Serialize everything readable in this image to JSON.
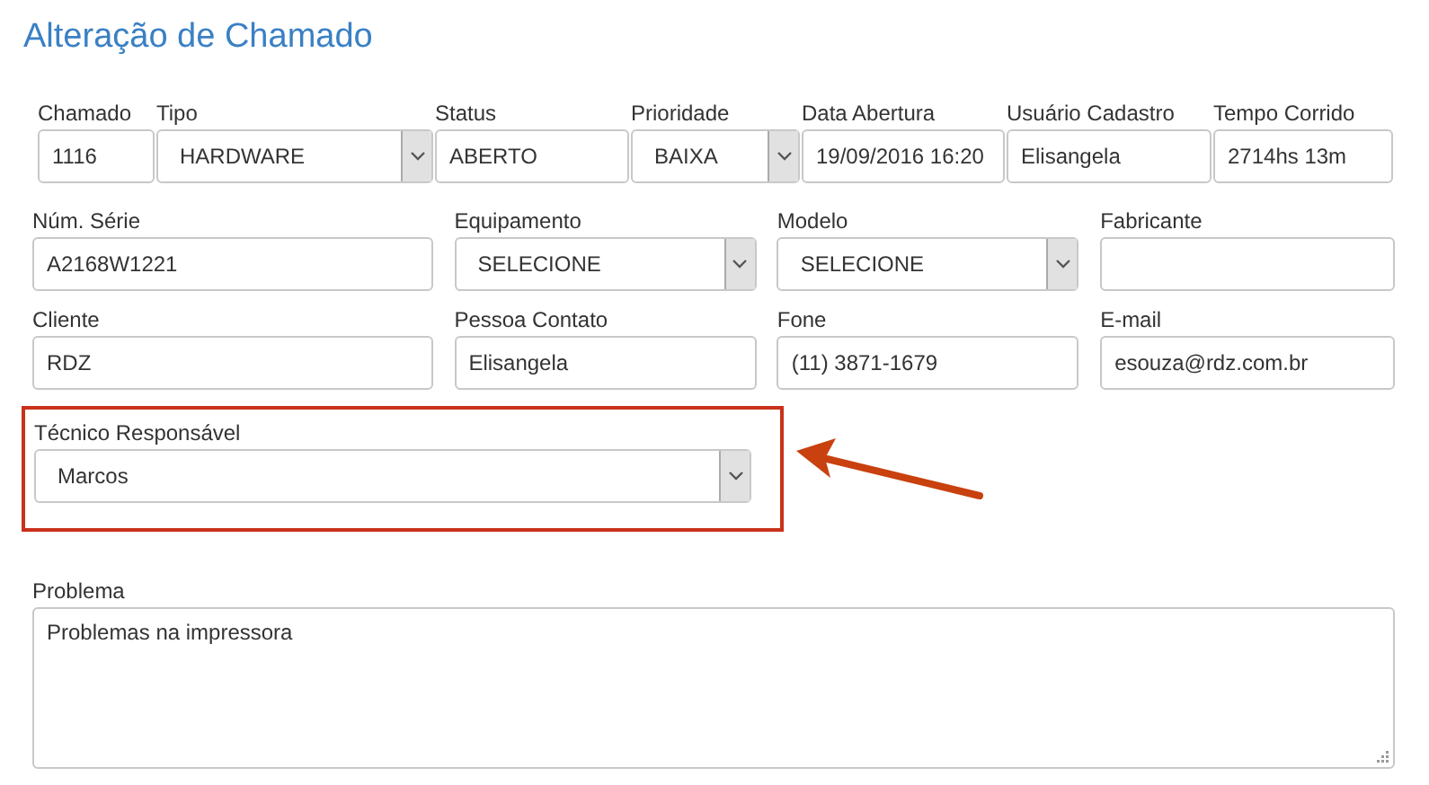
{
  "title": "Alteração de Chamado",
  "rows": [
    [
      {
        "label": "Chamado",
        "value": "1116",
        "kind": "text"
      },
      {
        "label": "Tipo",
        "value": "HARDWARE",
        "kind": "select"
      },
      {
        "label": "Status",
        "value": "ABERTO",
        "kind": "text"
      },
      {
        "label": "Prioridade",
        "value": "BAIXA",
        "kind": "select"
      },
      {
        "label": "Data Abertura",
        "value": "19/09/2016 16:20",
        "kind": "text"
      },
      {
        "label": "Usuário Cadastro",
        "value": "Elisangela",
        "kind": "text"
      },
      {
        "label": "Tempo Corrido",
        "value": "2714hs 13m",
        "kind": "text"
      }
    ],
    [
      {
        "label": "Núm. Série",
        "value": "A2168W1221",
        "kind": "text"
      },
      {
        "label": "Equipamento",
        "value": "SELECIONE",
        "kind": "select"
      },
      {
        "label": "Modelo",
        "value": "SELECIONE",
        "kind": "select"
      },
      {
        "label": "Fabricante",
        "kind": "text"
      }
    ],
    [
      {
        "label": "Cliente",
        "value": "RDZ",
        "kind": "text"
      },
      {
        "label": "Pessoa Contato",
        "value": "Elisangela",
        "kind": "text"
      },
      {
        "label": "Fone",
        "value": "(11) 3871-1679",
        "kind": "text"
      },
      {
        "label": "E-mail",
        "value": "esouza@rdz.com.br",
        "kind": "text"
      }
    ]
  ],
  "technician": {
    "label": "Técnico Responsável",
    "value": "Marcos",
    "kind": "select",
    "highlighted": true
  },
  "problem": {
    "label": "Problema",
    "value": "Problemas na impressora"
  }
}
